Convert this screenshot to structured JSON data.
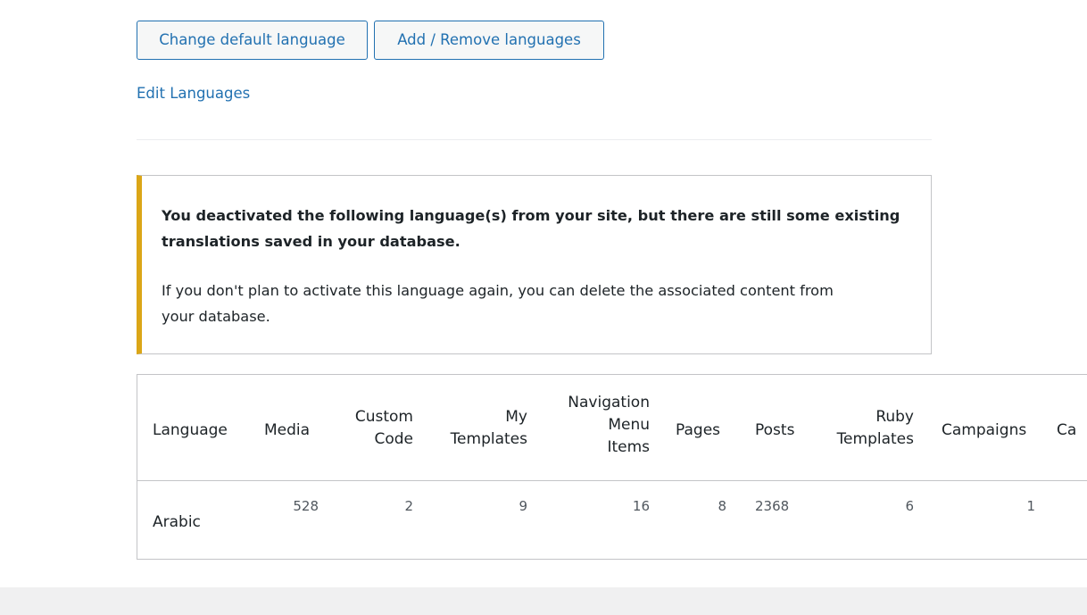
{
  "buttons": {
    "change_default": "Change default language",
    "add_remove": "Add / Remove languages"
  },
  "edit_link": "Edit Languages",
  "notice": {
    "strong_line1": "You deactivated the following language(s) from your site, but there are still some existing",
    "strong_line2": "translations saved in your database.",
    "text_line1": "If you don't plan to activate this language again, you can delete the associated content from",
    "text_line2": "your database.",
    "accent_color": "#dba617"
  },
  "table": {
    "headers": {
      "language": "Language",
      "media": "Media",
      "custom_code_1": "Custom",
      "custom_code_2": "Code",
      "my_templates_1": "My",
      "my_templates_2": "Templates",
      "nav_1": "Navigation",
      "nav_2": "Menu",
      "nav_3": "Items",
      "pages": "Pages",
      "posts": "Posts",
      "ruby_1": "Ruby",
      "ruby_2": "Templates",
      "campaigns": "Campaigns",
      "ca_truncated": "Ca"
    },
    "rows": [
      {
        "language": "Arabic",
        "media": "528",
        "custom_code": "2",
        "my_templates": "9",
        "navigation_menu_items": "16",
        "pages": "8",
        "posts": "2368",
        "ruby_templates": "6",
        "campaigns": "1"
      }
    ]
  },
  "colors": {
    "link": "#2271b1",
    "border": "#c3c4c7",
    "footer_bg": "#f0f0f1"
  }
}
